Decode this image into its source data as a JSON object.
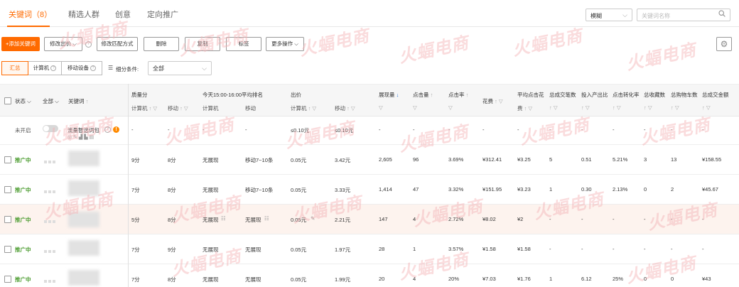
{
  "tabs": [
    {
      "label": "关键词（8）",
      "active": true
    },
    {
      "label": "精选人群",
      "active": false
    },
    {
      "label": "创意",
      "active": false
    },
    {
      "label": "定向推广",
      "active": false
    }
  ],
  "search": {
    "mode": "模糊",
    "placeholder": "关键词名称"
  },
  "toolbar": {
    "add_keyword": "+添加关键词",
    "modify_bid": "修改出价",
    "modify_match": "修改匹配方式",
    "delete": "删除",
    "copy": "复制",
    "tag": "标签",
    "more_ops": "更多操作"
  },
  "view": {
    "summary": "汇总",
    "computer": "计算机",
    "mobile": "移动设备",
    "filter_label": "细分条件:",
    "filter_value": "全部"
  },
  "table": {
    "headers": {
      "status": "状态",
      "all": "全部",
      "keyword": "关键词",
      "quality_score": "质量分",
      "rank": "今天15:00-16:00平均排名",
      "bid": "出价",
      "impressions": "展现量",
      "clicks": "点击量",
      "ctr": "点击率",
      "cost": "花费",
      "avg_cpc": "平均点击花",
      "avg_cpc_2": "费",
      "total_txn": "总成交笔数",
      "roi": "投入产出比",
      "cvr": "点击转化率",
      "favorites": "总收藏数",
      "carts": "总购物车数",
      "gmv": "总成交金额",
      "computer": "计算机",
      "mobile": "移动"
    },
    "special_row": {
      "status": "未开启",
      "keyword": "流量智选词包",
      "dash": "-",
      "bid_pc": "≤0.10元",
      "bid_mobile": "≤0.10元"
    },
    "rows": [
      {
        "status": "推广中",
        "qs_pc": "9分",
        "qs_m": "8分",
        "rank_pc": "无展现",
        "rank_m": "移动7~10条",
        "bid_pc": "0.05元",
        "bid_m": "3.42元",
        "impr": "2,605",
        "clicks": "96",
        "ctr": "3.69%",
        "cost": "¥312.41",
        "cpc": "¥3.25",
        "txn": "5",
        "roi": "0.51",
        "cvr": "5.21%",
        "fav": "3",
        "cart": "13",
        "gmv": "¥158.55"
      },
      {
        "status": "推广中",
        "qs_pc": "7分",
        "qs_m": "8分",
        "rank_pc": "无展现",
        "rank_m": "移动7~10条",
        "bid_pc": "0.05元",
        "bid_m": "3.33元",
        "impr": "1,414",
        "clicks": "47",
        "ctr": "3.32%",
        "cost": "¥151.95",
        "cpc": "¥3.23",
        "txn": "1",
        "roi": "0.30",
        "cvr": "2.13%",
        "fav": "0",
        "cart": "2",
        "gmv": "¥45.67"
      },
      {
        "status": "推广中",
        "qs_pc": "5分",
        "qs_m": "8分",
        "rank_pc": "无展现",
        "rank_m": "无展现",
        "bid_pc": "0.05元",
        "bid_m": "2.21元",
        "impr": "147",
        "clicks": "4",
        "ctr": "2.72%",
        "cost": "¥8.02",
        "cpc": "¥2",
        "txn": "-",
        "roi": "-",
        "cvr": "-",
        "fav": "-",
        "cart": "-",
        "gmv": "-"
      },
      {
        "status": "推广中",
        "qs_pc": "7分",
        "qs_m": "9分",
        "rank_pc": "无展现",
        "rank_m": "无展现",
        "bid_pc": "0.05元",
        "bid_m": "1.97元",
        "impr": "28",
        "clicks": "1",
        "ctr": "3.57%",
        "cost": "¥1.58",
        "cpc": "¥1.58",
        "txn": "-",
        "roi": "-",
        "cvr": "-",
        "fav": "-",
        "cart": "-",
        "gmv": "-"
      },
      {
        "status": "推广中",
        "qs_pc": "7分",
        "qs_m": "8分",
        "rank_pc": "无展现",
        "rank_m": "无展现",
        "bid_pc": "0.05元",
        "bid_m": "1.99元",
        "impr": "20",
        "clicks": "4",
        "ctr": "20%",
        "cost": "¥7.03",
        "cpc": "¥1.76",
        "txn": "1",
        "roi": "6.12",
        "cvr": "25%",
        "fav": "0",
        "cart": "0",
        "gmv": "¥43"
      }
    ]
  },
  "watermark": "火蝠电商",
  "colors": {
    "accent": "#ff6a00",
    "status_green": "#4a9b2e",
    "highlight_row": "#fdf3ee"
  }
}
